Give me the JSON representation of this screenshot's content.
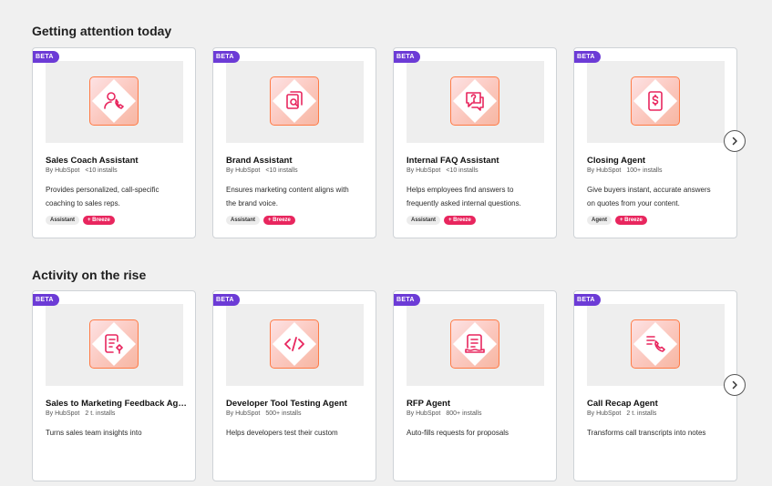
{
  "sections": [
    {
      "title": "Getting attention today",
      "cards": [
        {
          "badge": "BETA",
          "name": "Sales Coach Assistant",
          "by": "By HubSpot",
          "installs": "<10 installs",
          "desc1": "Provides personalized, call-specific",
          "desc2": "coaching to sales reps.",
          "tag": "Assistant",
          "breeze": "+ Breeze",
          "icon": "user-phone-icon"
        },
        {
          "badge": "BETA",
          "name": "Brand Assistant",
          "by": "By HubSpot",
          "installs": "<10 installs",
          "desc1": "Ensures marketing content aligns with",
          "desc2": "the brand voice.",
          "tag": "Assistant",
          "breeze": "+ Breeze",
          "icon": "brand-document-icon"
        },
        {
          "badge": "BETA",
          "name": "Internal FAQ Assistant",
          "by": "By HubSpot",
          "installs": "<10 installs",
          "desc1": "Helps employees find answers to",
          "desc2": "frequently asked internal questions.",
          "tag": "Assistant",
          "breeze": "+ Breeze",
          "icon": "question-chat-icon"
        },
        {
          "badge": "BETA",
          "name": "Closing Agent",
          "by": "By HubSpot",
          "installs": "100+ installs",
          "desc1": "Give buyers instant, accurate answers",
          "desc2": "on quotes from your content.",
          "tag": "Agent",
          "breeze": "+ Breeze",
          "icon": "dollar-document-icon"
        }
      ]
    },
    {
      "title": "Activity on the rise",
      "cards": [
        {
          "badge": "BETA",
          "name": "Sales to Marketing Feedback Agent",
          "by": "By HubSpot",
          "installs": "2 t. installs",
          "desc1": "Turns sales team insights into",
          "desc2": "",
          "icon": "feedback-document-icon"
        },
        {
          "badge": "BETA",
          "name": "Developer Tool Testing Agent",
          "by": "By HubSpot",
          "installs": "500+ installs",
          "desc1": "Helps developers test their custom",
          "desc2": "",
          "icon": "code-icon"
        },
        {
          "badge": "BETA",
          "name": "RFP Agent",
          "by": "By HubSpot",
          "installs": "800+ installs",
          "desc1": "Auto-fills requests for proposals",
          "desc2": "",
          "icon": "rfp-document-icon"
        },
        {
          "badge": "BETA",
          "name": "Call Recap Agent",
          "by": "By HubSpot",
          "installs": "2 t. installs",
          "desc1": "Transforms call transcripts into notes",
          "desc2": "",
          "icon": "call-recap-icon"
        }
      ]
    }
  ],
  "next_label": "Next",
  "colors": {
    "badge": "#6c3bd6",
    "breeze": "#e8265e",
    "icon_stroke": "#e8265e",
    "tile_border": "#ff7a45"
  }
}
